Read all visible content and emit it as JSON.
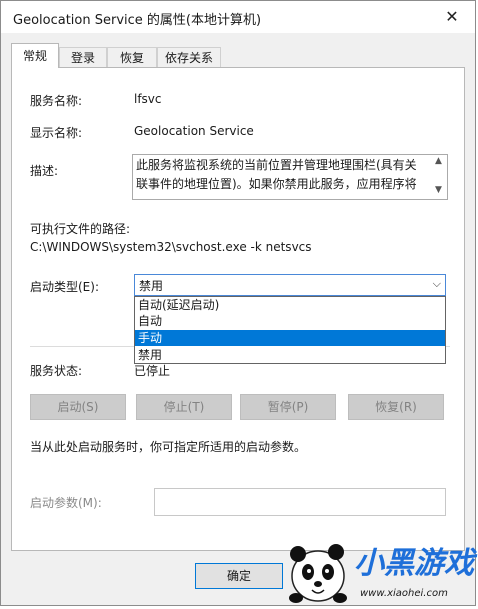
{
  "window": {
    "title": "Geolocation Service 的属性(本地计算机)",
    "close_glyph": "✕"
  },
  "tabs": [
    {
      "label": "常规"
    },
    {
      "label": "登录"
    },
    {
      "label": "恢复"
    },
    {
      "label": "依存关系"
    }
  ],
  "general": {
    "service_name_label": "服务名称:",
    "service_name": "lfsvc",
    "display_name_label": "显示名称:",
    "display_name": "Geolocation Service",
    "description_label": "描述:",
    "description": "此服务将监视系统的当前位置并管理地理围栏(具有关联事件的地理位置)。如果你禁用此服务，应用程序将",
    "exe_path_label": "可执行文件的路径:",
    "exe_path": "C:\\WINDOWS\\system32\\svchost.exe -k netsvcs",
    "startup_type_label": "启动类型(E):",
    "startup_type_value": "禁用",
    "startup_options": [
      "自动(延迟启动)",
      "自动",
      "手动",
      "禁用"
    ],
    "highlighted_option": "手动",
    "service_status_label": "服务状态:",
    "service_status": "已停止",
    "buttons": {
      "start": "启动(S)",
      "stop": "停止(T)",
      "pause": "暂停(P)",
      "resume": "恢复(R)"
    },
    "start_params_hint": "当从此处启动服务时，你可指定所适用的启动参数。",
    "start_params_label": "启动参数(M):",
    "start_params_value": ""
  },
  "footer": {
    "ok_label": "确定"
  },
  "watermark": {
    "brand": "小黑游戏",
    "url": "www.xiaohei.com"
  },
  "colors": {
    "selection": "#0078d7",
    "focus_border": "#4a88d8",
    "watermark_blue": "#1e6fd9"
  }
}
